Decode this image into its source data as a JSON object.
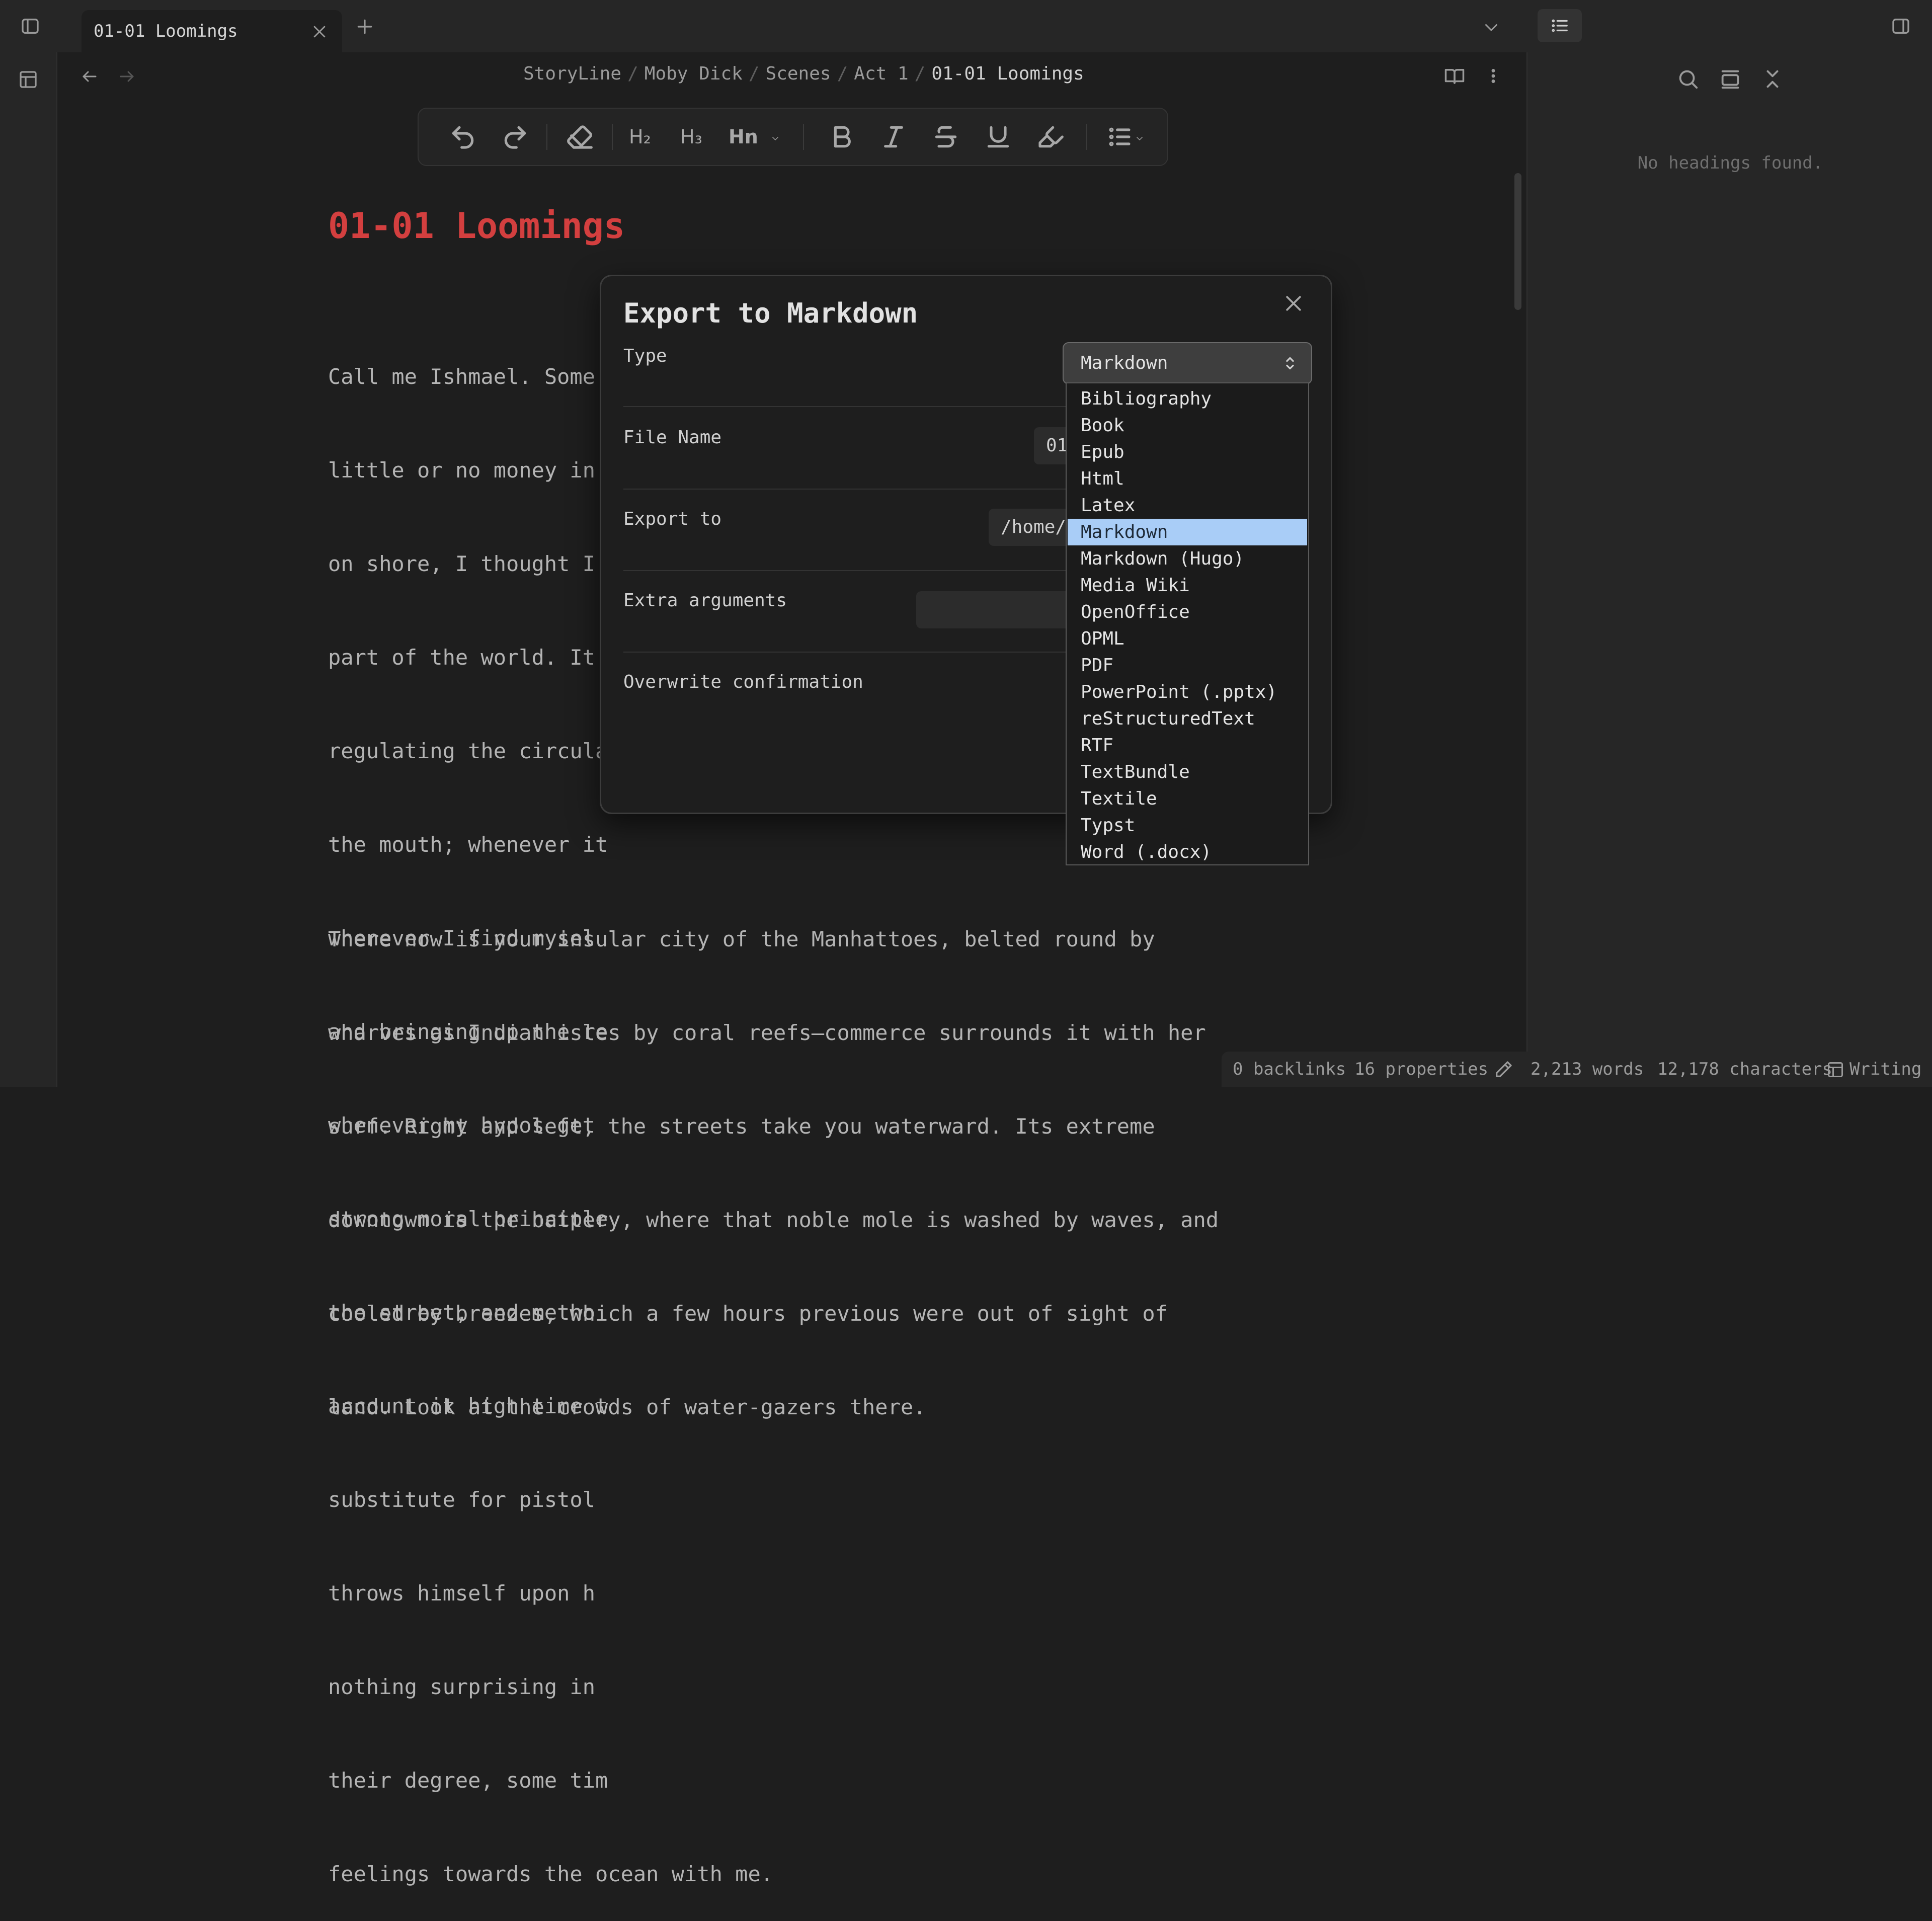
{
  "tabs": [
    {
      "title": "01-01 Loomings"
    }
  ],
  "breadcrumb": {
    "items": [
      "StoryLine",
      "Moby Dick",
      "Scenes",
      "Act 1"
    ],
    "current": "01-01 Loomings",
    "separator": "/"
  },
  "toolbar": {
    "h2": "H₂",
    "h3": "H₃",
    "hn": "Hn"
  },
  "document": {
    "title": "01-01 Loomings",
    "paragraph1_lines": [
      "Call me Ishmael. Some",
      "little or no money in",
      "on shore, I thought I",
      "part of the world. It",
      "regulating the circula",
      "the mouth; whenever it",
      "whenever I find mysel",
      "and bringing up the re",
      "whenever my hypos get",
      "strong moral principle",
      "the street, and metho",
      "account it high time t",
      "substitute for pistol",
      "throws himself upon h",
      "nothing surprising in",
      "their degree, some tim",
      "feelings towards the ocean with me."
    ],
    "paragraph2_lines": [
      "There now is your insular city of the Manhattoes, belted round by",
      "wharves as Indian isles by coral reefs—commerce surrounds it with her",
      "surf. Right and left, the streets take you waterward. Its extreme",
      "downtown is the battery, where that noble mole is washed by waves, and",
      "cooled by breezes, which a few hours previous were out of sight of",
      "land. Look at the crowds of water-gazers there."
    ]
  },
  "outline": {
    "empty_text": "No headings found."
  },
  "status": {
    "backlinks": "0 backlinks",
    "properties": "16 properties",
    "words": "2,213 words",
    "characters": "12,178 characters",
    "mode": "Writing"
  },
  "modal": {
    "title": "Export to Markdown",
    "fields": {
      "type_label": "Type",
      "type_value": "Markdown",
      "file_name_label": "File Name",
      "file_name_value": "01",
      "export_to_label": "Export to",
      "export_to_value": "/home/c",
      "extra_args_label": "Extra arguments",
      "extra_args_value": "",
      "overwrite_label": "Overwrite confirmation"
    },
    "type_options": [
      "Bibliography",
      "Book",
      "Epub",
      "Html",
      "Latex",
      "Markdown",
      "Markdown (Hugo)",
      "Media Wiki",
      "OpenOffice",
      "OPML",
      "PDF",
      "PowerPoint (.pptx)",
      "reStructuredText",
      "RTF",
      "TextBundle",
      "Textile",
      "Typst",
      "Word (.docx)"
    ],
    "selected_option": "Markdown"
  },
  "colors": {
    "title_red": "#d33f3f",
    "selected_option_bg": "#a9cdf7",
    "background": "#1e1e1e",
    "panel": "#262626"
  }
}
